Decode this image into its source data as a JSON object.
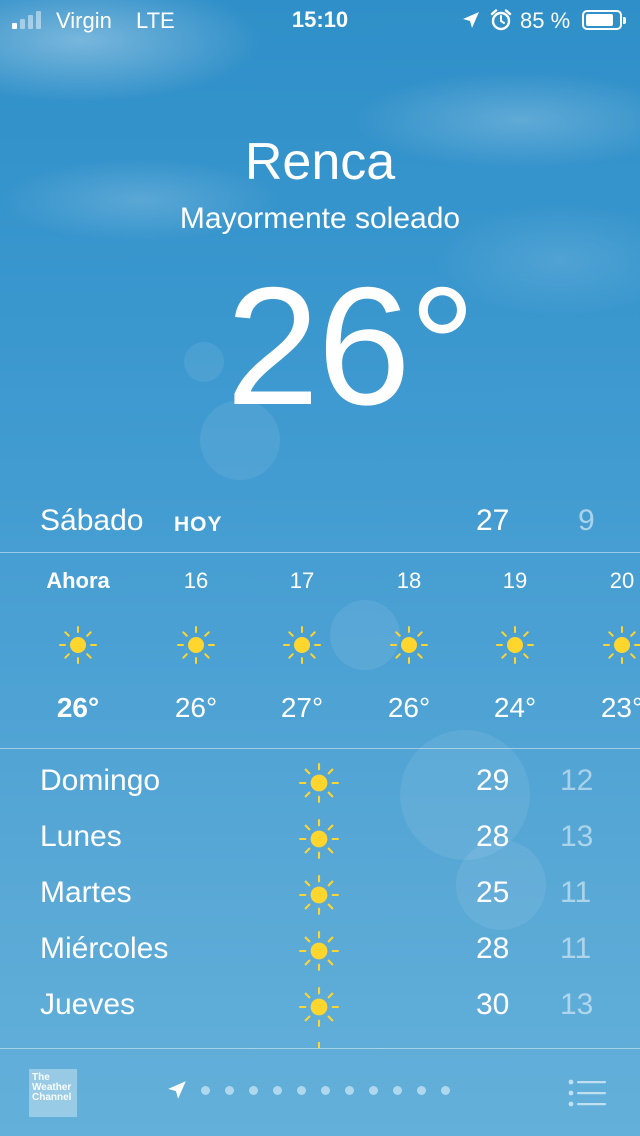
{
  "status_bar": {
    "carrier": "Virgin",
    "network": "LTE",
    "time": "15:10",
    "battery": "85 %",
    "battery_level": 0.85,
    "signal_bars_filled": 1,
    "signal_bars_total": 4,
    "icons": [
      "location-arrow-icon",
      "alarm-clock-icon",
      "battery-icon"
    ]
  },
  "location": {
    "city": "Renca",
    "condition": "Mayormente soleado",
    "current_temp": "26°"
  },
  "today": {
    "day": "Sábado",
    "label": "HOY",
    "high": "27",
    "low": "9"
  },
  "hourly": [
    {
      "time": "Ahora",
      "temp": "26°",
      "icon": "sun-icon"
    },
    {
      "time": "16",
      "temp": "26°",
      "icon": "sun-icon"
    },
    {
      "time": "17",
      "temp": "27°",
      "icon": "sun-icon"
    },
    {
      "time": "18",
      "temp": "26°",
      "icon": "sun-icon"
    },
    {
      "time": "19",
      "temp": "24°",
      "icon": "sun-icon"
    },
    {
      "time": "20",
      "temp": "23°",
      "icon": "sun-icon"
    }
  ],
  "daily": [
    {
      "day": "Domingo",
      "high": "29",
      "low": "12",
      "icon": "sun-icon"
    },
    {
      "day": "Lunes",
      "high": "28",
      "low": "13",
      "icon": "sun-icon"
    },
    {
      "day": "Martes",
      "high": "25",
      "low": "11",
      "icon": "sun-icon"
    },
    {
      "day": "Miércoles",
      "high": "28",
      "low": "11",
      "icon": "sun-icon"
    },
    {
      "day": "Jueves",
      "high": "30",
      "low": "13",
      "icon": "sun-icon"
    }
  ],
  "toolbar": {
    "logo_text": "The Weather Channel",
    "page_dots": 11,
    "icons": [
      "location-arrow-icon",
      "list-icon"
    ]
  },
  "colors": {
    "sun": "#ffd52e",
    "background_top": "#2f8fc8",
    "background_bottom": "#63b0da"
  }
}
